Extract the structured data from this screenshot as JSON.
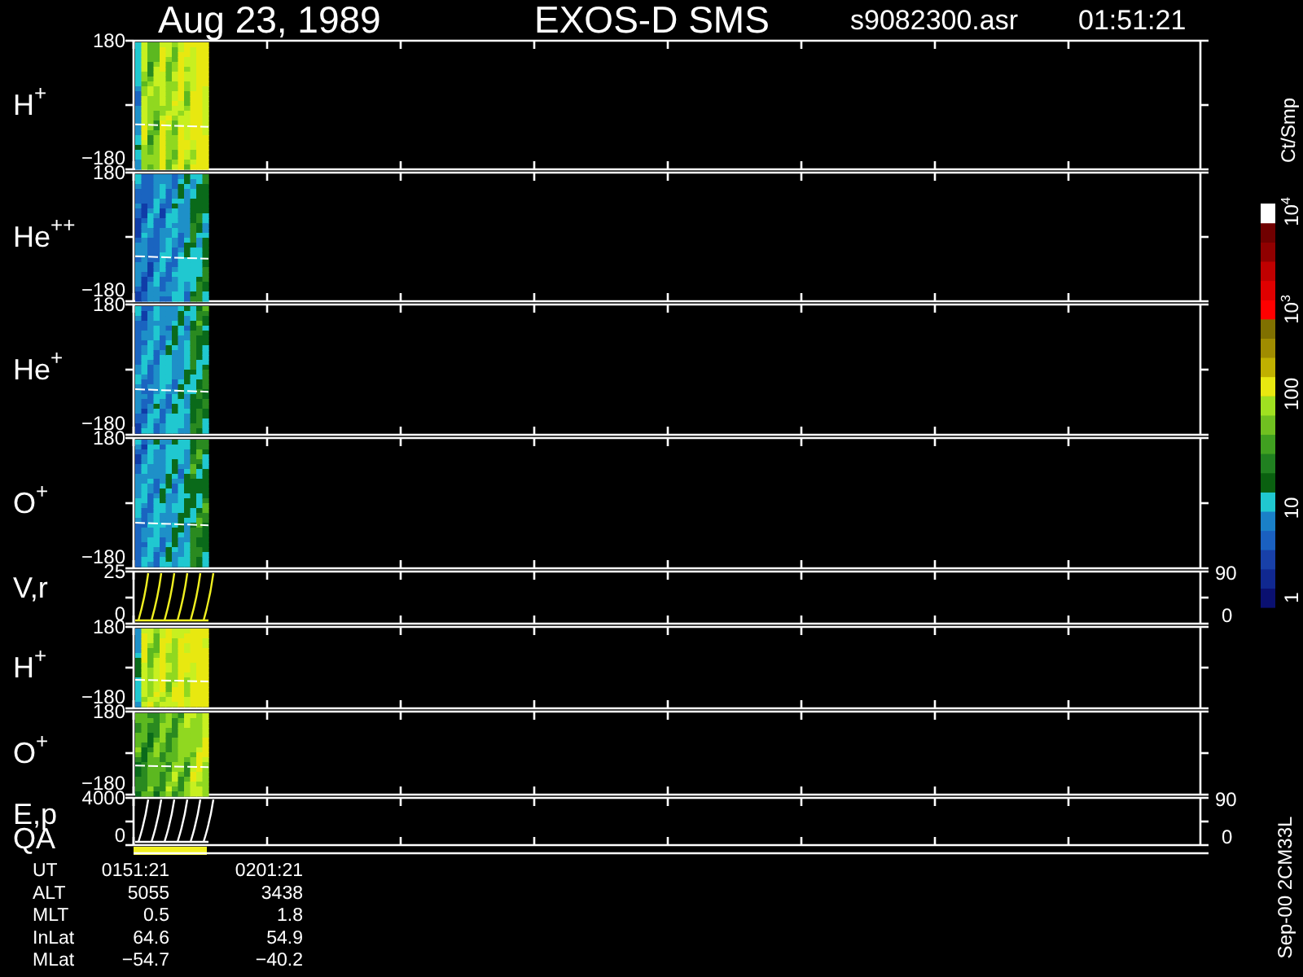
{
  "header": {
    "date": "Aug 23, 1989",
    "instrument": "EXOS-D SMS",
    "file": "s9082300.asr",
    "time": "01:51:21"
  },
  "panels": [
    {
      "kind": "spectrogram",
      "symbol": "H",
      "charge": "+",
      "y_max": "180",
      "y_min": "−180"
    },
    {
      "kind": "spectrogram",
      "symbol": "He",
      "charge": "++",
      "y_max": "180",
      "y_min": "−180"
    },
    {
      "kind": "spectrogram",
      "symbol": "He",
      "charge": "+",
      "y_max": "180",
      "y_min": "−180"
    },
    {
      "kind": "spectrogram",
      "symbol": "O",
      "charge": "+",
      "y_max": "180",
      "y_min": "−180"
    },
    {
      "kind": "line",
      "symbol": "V,r",
      "y_max": "25",
      "y_min": "0",
      "right_max": "90",
      "right_min": "0"
    },
    {
      "kind": "spectrogram",
      "symbol": "H",
      "charge": "+",
      "y_max": "180",
      "y_min": "−180"
    },
    {
      "kind": "spectrogram",
      "symbol": "O",
      "charge": "+",
      "y_max": "180",
      "y_min": "−180"
    },
    {
      "kind": "line",
      "symbol": "E,p",
      "sub_label": "QA",
      "y_max": "4000",
      "y_min": "0",
      "right_max": "90",
      "right_min": "0"
    }
  ],
  "colorbar": {
    "unit": "Ct/Smp",
    "ticks": [
      {
        "base": "10",
        "exp": "4"
      },
      {
        "base": "10",
        "exp": "3"
      },
      {
        "base": "100"
      },
      {
        "base": "10"
      },
      {
        "base": "1"
      }
    ]
  },
  "footer_code": "Sep-00 2CM33L",
  "orbit_table": [
    {
      "label": "UT",
      "values": [
        "0151:21",
        "0201:21"
      ]
    },
    {
      "label": "ALT",
      "values": [
        "5055",
        "3438"
      ]
    },
    {
      "label": "MLT",
      "values": [
        "0.5",
        "1.8"
      ]
    },
    {
      "label": "InLat",
      "values": [
        "64.6",
        "54.9"
      ]
    },
    {
      "label": "MLat",
      "values": [
        "−54.7",
        "−40.2"
      ]
    }
  ]
}
